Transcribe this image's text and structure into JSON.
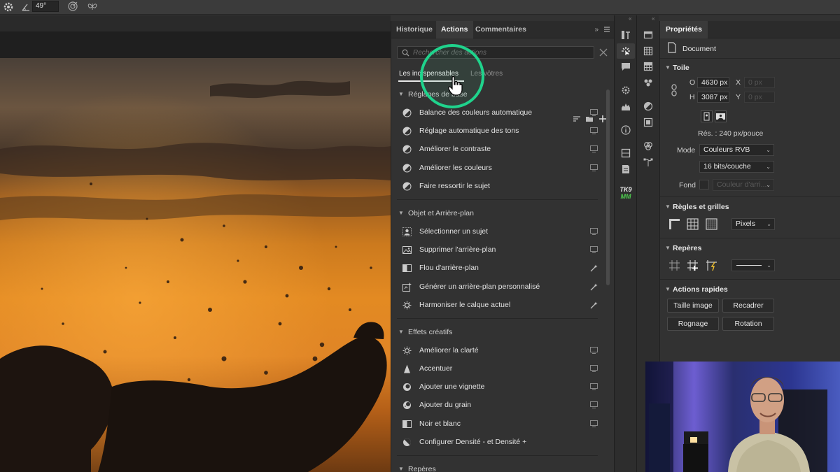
{
  "option_bar": {
    "angle_value": "49°"
  },
  "actions_panel": {
    "tabs": [
      {
        "label": "Historique",
        "active": false
      },
      {
        "label": "Actions",
        "active": true
      },
      {
        "label": "Commentaires",
        "active": false
      }
    ],
    "overflow_label": "»",
    "search": {
      "placeholder": "Rechercher des actions",
      "value": ""
    },
    "subtabs": [
      {
        "label": "Les indispensables",
        "active": true
      },
      {
        "label": "Les vôtres",
        "active": false
      }
    ],
    "sections": [
      {
        "title": "Réglages de base",
        "items": [
          {
            "label": "Balance des couleurs automatique",
            "icon": "half-circle-icon",
            "action": "play-icon"
          },
          {
            "label": "Réglage automatique des tons",
            "icon": "half-circle-icon",
            "action": "play-icon"
          },
          {
            "label": "Améliorer le contraste",
            "icon": "half-circle-icon",
            "action": "play-icon"
          },
          {
            "label": "Améliorer les couleurs",
            "icon": "half-circle-icon",
            "action": "play-icon"
          },
          {
            "label": "Faire ressortir le sujet",
            "icon": "half-circle-icon",
            "action": ""
          }
        ]
      },
      {
        "title": "Objet et Arrière-plan",
        "items": [
          {
            "label": "Sélectionner un sujet",
            "icon": "person-icon",
            "action": "play-icon"
          },
          {
            "label": "Supprimer l'arrière-plan",
            "icon": "image-icon",
            "action": "play-icon"
          },
          {
            "label": "Flou d'arrière-plan",
            "icon": "blur-icon",
            "action": "magic-wand-icon"
          },
          {
            "label": "Générer un arrière-plan personnalisé",
            "icon": "generate-icon",
            "action": "magic-wand-icon"
          },
          {
            "label": "Harmoniser le calque actuel",
            "icon": "harmonize-icon",
            "action": "magic-wand-icon"
          }
        ]
      },
      {
        "title": "Effets créatifs",
        "items": [
          {
            "label": "Améliorer la clarté",
            "icon": "sun-icon",
            "action": "play-icon"
          },
          {
            "label": "Accentuer",
            "icon": "triangle-icon",
            "action": "play-icon"
          },
          {
            "label": "Ajouter une vignette",
            "icon": "vignette-icon",
            "action": "play-icon"
          },
          {
            "label": "Ajouter du grain",
            "icon": "grain-icon",
            "action": "play-icon"
          },
          {
            "label": "Noir et blanc",
            "icon": "bw-icon",
            "action": "play-icon"
          },
          {
            "label": "Configurer Densité - et Densité +",
            "icon": "dodge-icon",
            "action": ""
          }
        ]
      },
      {
        "title": "Repères",
        "items": []
      }
    ]
  },
  "properties": {
    "tab": "Propriétés",
    "document_label": "Document",
    "canvas": {
      "title": "Toile",
      "w_label": "O",
      "w_value": "4630 px",
      "x_label": "X",
      "x_value": "0 px",
      "h_label": "H",
      "h_value": "3087 px",
      "y_label": "Y",
      "y_value": "0 px",
      "resolution": "Rés. : 240 px/pouce",
      "mode_label": "Mode",
      "mode_value": "Couleurs RVB",
      "bits_value": "16 bits/couche",
      "fond_label": "Fond",
      "fond_value": "Couleur d'arri..."
    },
    "rulers": {
      "title": "Règles et grilles",
      "unit": "Pixels"
    },
    "guides": {
      "title": "Repères"
    },
    "quick": {
      "title": "Actions rapides",
      "buttons": [
        "Taille image",
        "Recadrer",
        "Rognage",
        "Rotation"
      ]
    }
  },
  "strip_labels": {
    "tk9": "TK9",
    "mm": "MM"
  },
  "colors": {
    "accent_highlight": "#1fd38c",
    "panel_bg": "#323232",
    "tab_bg": "#2b2b2b"
  }
}
